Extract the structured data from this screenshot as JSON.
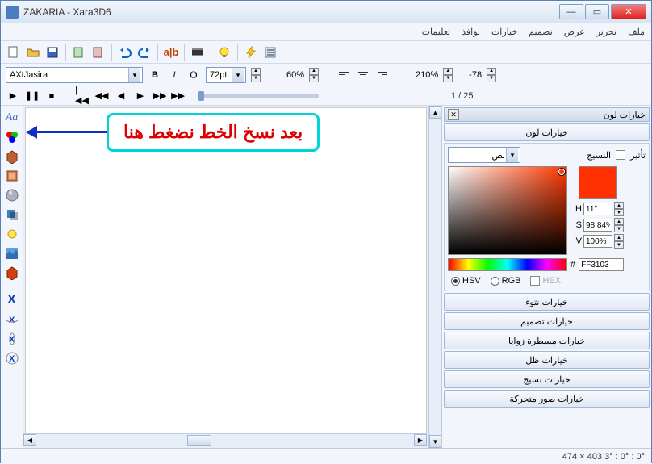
{
  "title": "ZAKARIA - Xara3D6",
  "menu": [
    "ملف",
    "تحرير",
    "عرض",
    "تصميم",
    "خيارات",
    "نوافذ",
    "تعليمات"
  ],
  "font_name": "AXtJasira",
  "font_size": "72pt",
  "zoom1": "60%",
  "zoom2": "210%",
  "kerning": "-78",
  "frame": "1 / 25",
  "callout": "بعد نسخ الخط نضغط هنا",
  "panel": {
    "title": "خيارات لون",
    "main_btn": "خيارات لون",
    "effect": "تأثير",
    "texture": "النسيج",
    "layer": "نص",
    "h": "11°",
    "s": "98.84%",
    "v": "100%",
    "hex": "FF3103",
    "mode_hsv": "HSV",
    "mode_rgb": "RGB",
    "mode_hex": "HEX",
    "buttons": [
      "خيارات نتوء",
      "خيارات تصميم",
      "خيارات مسطرة زوايا",
      "خيارات ظل",
      "خيارات نسيج",
      "خيارات صور متحركة"
    ]
  },
  "status": "474 × 403  3° : 0° : 0°"
}
